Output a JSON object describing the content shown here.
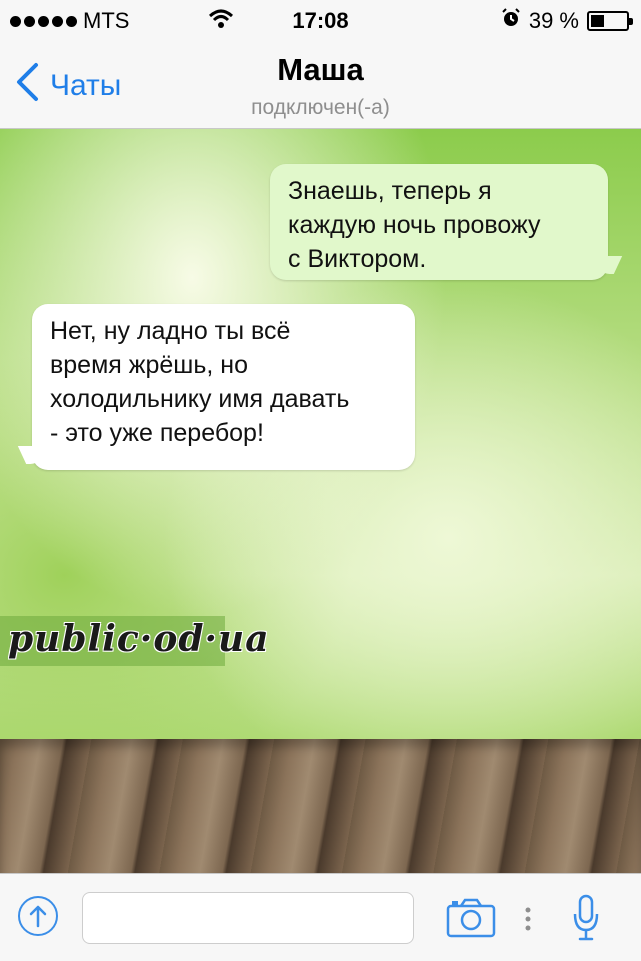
{
  "status_bar": {
    "carrier": "MTS",
    "time": "17:08",
    "battery": "39 %",
    "battery_level": 0.39
  },
  "header": {
    "back_label": "Чаты",
    "contact_name": "Маша",
    "contact_status": "подключен(-а)"
  },
  "messages": [
    {
      "direction": "outgoing",
      "lines": [
        "Знаешь, теперь я",
        "каждую ночь провожу",
        "с Виктором."
      ]
    },
    {
      "direction": "incoming",
      "lines": [
        "Нет, ну ладно ты всё",
        "время жрёшь, но",
        "холодильнику имя давать",
        "- это уже перебор!"
      ]
    }
  ],
  "watermark": "public·od·ua",
  "input_bar": {
    "message_value": "",
    "message_placeholder": ""
  },
  "icons": [
    "signal-dots-icon",
    "wifi-icon",
    "alarm-icon",
    "battery-icon",
    "back-chevron-icon",
    "upload-icon",
    "camera-icon",
    "more-dots-icon",
    "microphone-icon"
  ],
  "colors": {
    "accent": "#1f7ee8",
    "outgoing_bubble": "#e1f8cb",
    "incoming_bubble": "#ffffff"
  }
}
